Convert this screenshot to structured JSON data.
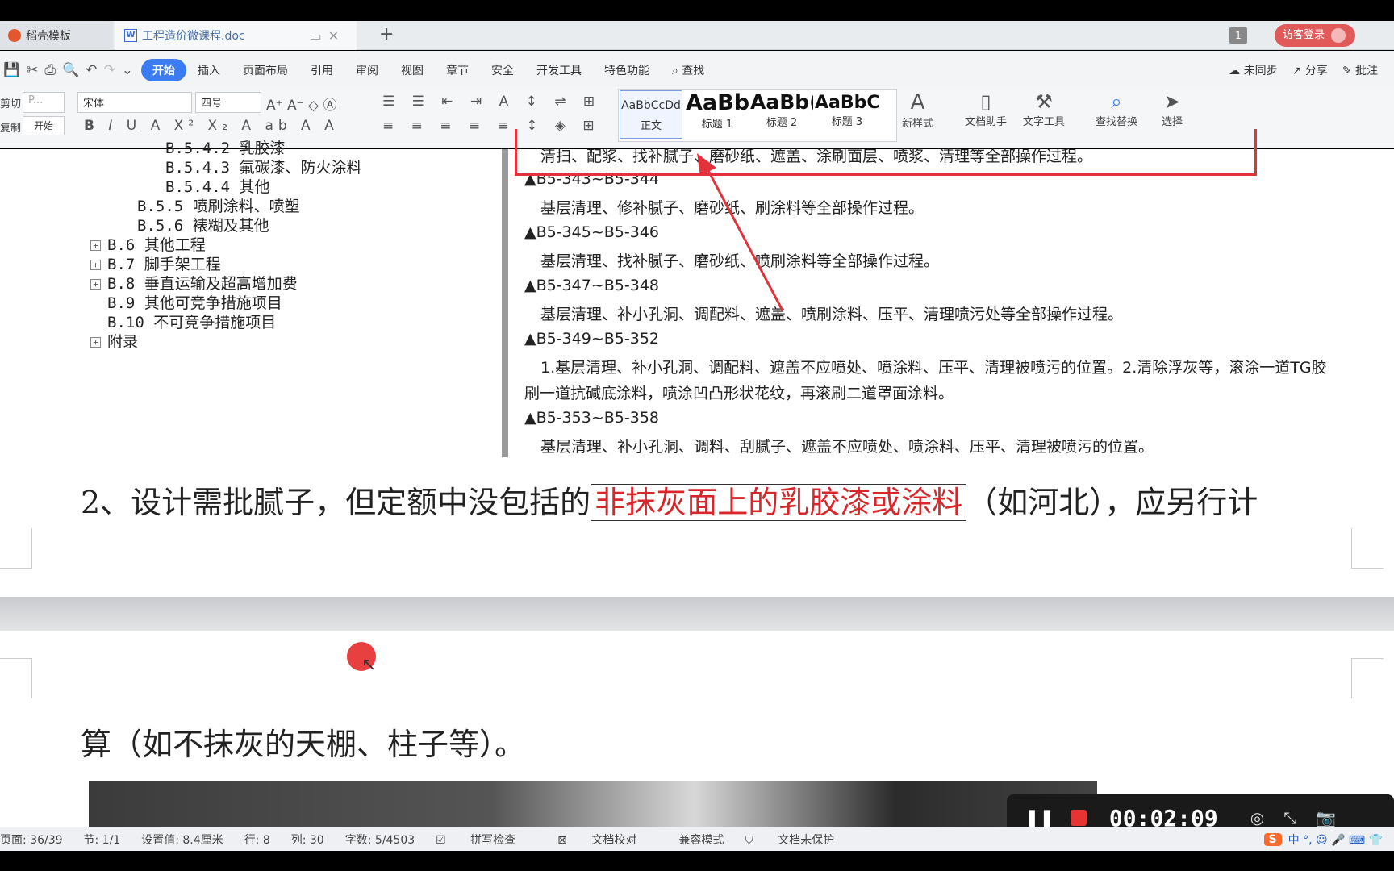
{
  "tabs": {
    "home": "稻壳模板",
    "doc": "工程造价微课程.doc",
    "badge": "1",
    "login": "访客登录"
  },
  "menu": {
    "items": [
      "开始",
      "插入",
      "页面布局",
      "引用",
      "审阅",
      "视图",
      "章节",
      "安全",
      "开发工具",
      "特色功能",
      "查找"
    ],
    "sync": "未同步",
    "share": "分享",
    "comment": "批注"
  },
  "ribbon": {
    "cut": "剪切",
    "copy": "复制",
    "paste_hint": "P...",
    "start_chip": "开始",
    "font": "宋体",
    "size": "四号",
    "styles": [
      {
        "sample": "AaBbCcDd",
        "name": "正文"
      },
      {
        "sample": "AaBb",
        "name": "标题 1"
      },
      {
        "sample": "AaBb(",
        "name": "标题 2"
      },
      {
        "sample": "AaBbC(",
        "name": "标题 3"
      }
    ],
    "new_style": "新样式",
    "doc_helper": "文档助手",
    "text_tool": "文字工具",
    "find_replace": "查找替换",
    "select": "选择"
  },
  "tree": [
    "B.5.4.2 乳胶漆",
    "B.5.4.3 氟碳漆、防火涂料",
    "B.5.4.4 其他",
    "B.5.5 喷刷涂料、喷塑",
    "B.5.6 裱糊及其他",
    "B.6 其他工程",
    "B.7 脚手架工程",
    "B.8 垂直运输及超高增加费",
    "B.9 其他可竞争措施项目",
    "B.10 不可竞争措施项目",
    "附录"
  ],
  "quota": {
    "line0": "清扫、配浆、找补腻子、磨砂纸、遮盖、涂刷面层、喷浆、清理等全部操作过程。",
    "h1": "▲B5-343~B5-344",
    "t1": "基层清理、修补腻子、磨砂纸、刷涂料等全部操作过程。",
    "h2": "▲B5-345~B5-346",
    "t2": "基层清理、找补腻子、磨砂纸、喷刷涂料等全部操作过程。",
    "h3": "▲B5-347~B5-348",
    "t3": "基层清理、补小孔洞、调配料、遮盖、喷刷涂料、压平、清理喷污处等全部操作过程。",
    "h4": "▲B5-349~B5-352",
    "t4a": "1.基层清理、补小孔洞、调配料、遮盖不应喷处、喷涂料、压平、清理被喷污的位置。2.清除浮灰等，滚涂一道TG胶",
    "t4b": "刷一道抗碱底涂料，喷涂凹凸形状花纹，再滚刷二道罩面涂料。",
    "h5": "▲B5-353~B5-358",
    "t5": "基层清理、补小孔洞、调料、刮腻子、遮盖不应喷处、喷涂料、压平、清理被喷污的位置。"
  },
  "body": {
    "p1_before": "2、设计需批腻子，但定额中没包括的",
    "p1_highlight": "非抹灰面上的乳胶漆或涂料",
    "p1_after": "（如河北），应另行计",
    "p2": "算（如不抹灰的天棚、柱子等）。"
  },
  "recorder": {
    "time": "00:02:09"
  },
  "status": {
    "page": "页面: 36/39",
    "section": "节: 1/1",
    "setting": "设置值: 8.4厘米",
    "row": "行: 8",
    "col": "列: 30",
    "words": "字数: 5/4503",
    "spell": "拼写检查",
    "proof": "文档校对",
    "compat": "兼容模式",
    "protect": "文档未保护"
  },
  "colors": {
    "accent": "#3c7cf2",
    "annotation_red": "#e2323a",
    "highlight_text": "#d8262b"
  }
}
